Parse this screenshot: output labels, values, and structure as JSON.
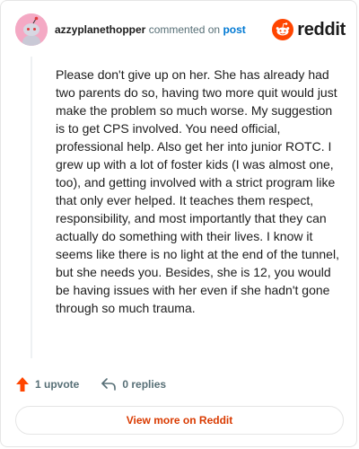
{
  "header": {
    "username": "azzyplanethopper",
    "action": "commented on",
    "post_link": "post",
    "brand": "reddit",
    "avatar_color": "#f4a9c4"
  },
  "comment": {
    "body": "Please don't give up on her. She has already had two parents do so, having two more quit would just make the problem so much worse. My suggestion is to get CPS involved. You need official, professional help. Also get her into junior ROTC. I grew up with a lot of foster kids (I was almost one, too), and getting involved with a strict program like that only ever helped. It teaches them respect, responsibility, and most importantly that they can actually do something with their lives. I know it seems like there is no light at the end of the tunnel, but she needs you. Besides, she is 12, you would be having issues with her even if she hadn't gone through so much trauma."
  },
  "footer": {
    "upvotes": "1 upvote",
    "replies": "0 replies",
    "upvote_icon": "upvote-arrow-icon",
    "reply_icon": "reply-arrow-icon"
  },
  "cta": {
    "label": "View more on Reddit"
  },
  "colors": {
    "brand_orange": "#ff4500",
    "link_blue": "#0079d3",
    "cta_text": "#d93a00",
    "muted": "#576f76"
  }
}
